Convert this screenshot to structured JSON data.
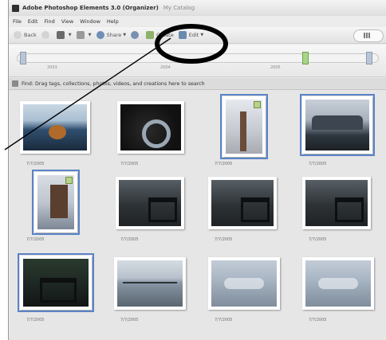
{
  "window": {
    "title": "Adobe Photoshop Elements 3.0 (Organizer)",
    "catalog": "My Catalog"
  },
  "menubar": {
    "items": [
      "File",
      "Edit",
      "Find",
      "View",
      "Window",
      "Help"
    ]
  },
  "toolbar": {
    "back_label": "Back",
    "share_label": "Share",
    "create_label": "Create",
    "edit_label": "Edit"
  },
  "timeline": {
    "years": [
      "2003",
      "2004",
      "2005"
    ]
  },
  "hint": {
    "text": "Find: Drag tags, collections, photos, videos, and creations here to search"
  },
  "photos": [
    {
      "date": "7/7/2005",
      "kind": "buoy",
      "selected": false
    },
    {
      "date": "7/7/2005",
      "kind": "wheel",
      "selected": false
    },
    {
      "date": "7/7/2005",
      "kind": "tower",
      "selected": true
    },
    {
      "date": "7/7/2005",
      "kind": "building",
      "selected": true
    },
    {
      "date": "7/7/2005",
      "kind": "pier",
      "selected": true
    },
    {
      "date": "7/7/2005",
      "kind": "bench",
      "selected": false
    },
    {
      "date": "7/7/2005",
      "kind": "bench",
      "selected": false
    },
    {
      "date": "7/7/2005",
      "kind": "bench",
      "selected": false
    },
    {
      "date": "7/7/2005",
      "kind": "bench2",
      "selected": true
    },
    {
      "date": "7/7/2005",
      "kind": "harbor",
      "selected": false
    },
    {
      "date": "7/7/2005",
      "kind": "sky",
      "selected": false
    },
    {
      "date": "7/7/2005",
      "kind": "sky",
      "selected": false
    }
  ],
  "colors": {
    "selection_outline": "#5a83c7",
    "annotation": "#000000"
  }
}
